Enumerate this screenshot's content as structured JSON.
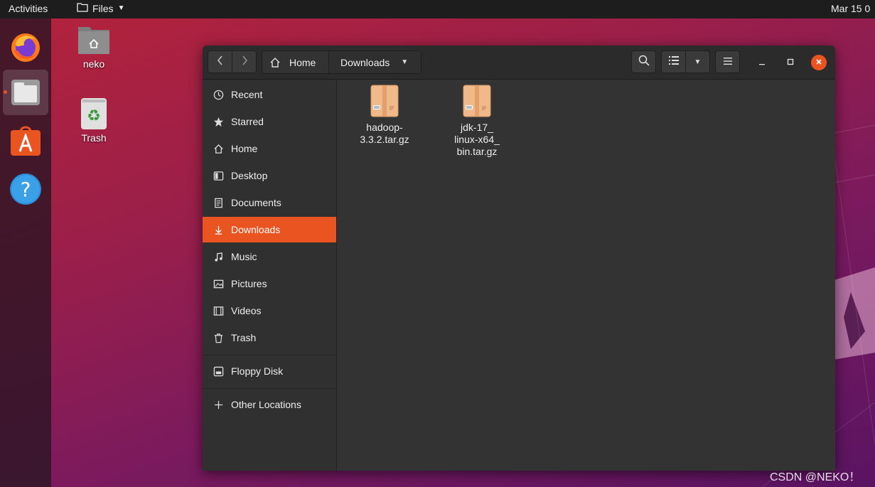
{
  "topbar": {
    "activities": "Activities",
    "app_name": "Files",
    "clock": "Mar 15 0"
  },
  "dock": {
    "items": [
      {
        "name": "firefox-icon"
      },
      {
        "name": "files-icon",
        "active": true
      },
      {
        "name": "ubuntu-software-icon"
      },
      {
        "name": "help-icon"
      }
    ]
  },
  "desktop": {
    "icons": [
      {
        "label": "neko",
        "icon": "home-folder-icon"
      },
      {
        "label": "Trash",
        "icon": "trash-icon"
      }
    ]
  },
  "window": {
    "pathbar": {
      "home": "Home",
      "current": "Downloads"
    },
    "sidebar": {
      "items": [
        {
          "label": "Recent",
          "icon": "clock-icon"
        },
        {
          "label": "Starred",
          "icon": "star-icon"
        },
        {
          "label": "Home",
          "icon": "home-icon"
        },
        {
          "label": "Desktop",
          "icon": "desktop-icon"
        },
        {
          "label": "Documents",
          "icon": "document-icon"
        },
        {
          "label": "Downloads",
          "icon": "download-icon",
          "active": true
        },
        {
          "label": "Music",
          "icon": "music-icon"
        },
        {
          "label": "Pictures",
          "icon": "picture-icon"
        },
        {
          "label": "Videos",
          "icon": "video-icon"
        },
        {
          "label": "Trash",
          "icon": "trash-icon"
        }
      ],
      "devices": [
        {
          "label": "Floppy Disk",
          "icon": "floppy-icon"
        }
      ],
      "other": {
        "label": "Other Locations",
        "icon": "plus-icon"
      }
    },
    "files": [
      {
        "name_lines": [
          "hadoop-",
          "3.3.2.tar.gz"
        ],
        "icon": "archive-icon"
      },
      {
        "name_lines": [
          "jdk-17_",
          "linux-x64_",
          "bin.tar.gz"
        ],
        "icon": "archive-icon"
      }
    ]
  },
  "watermark": "CSDN @NEKO！",
  "colors": {
    "accent": "#e95420",
    "headerbar": "#2b2b2b",
    "sidebar": "#303030",
    "content": "#333333"
  }
}
